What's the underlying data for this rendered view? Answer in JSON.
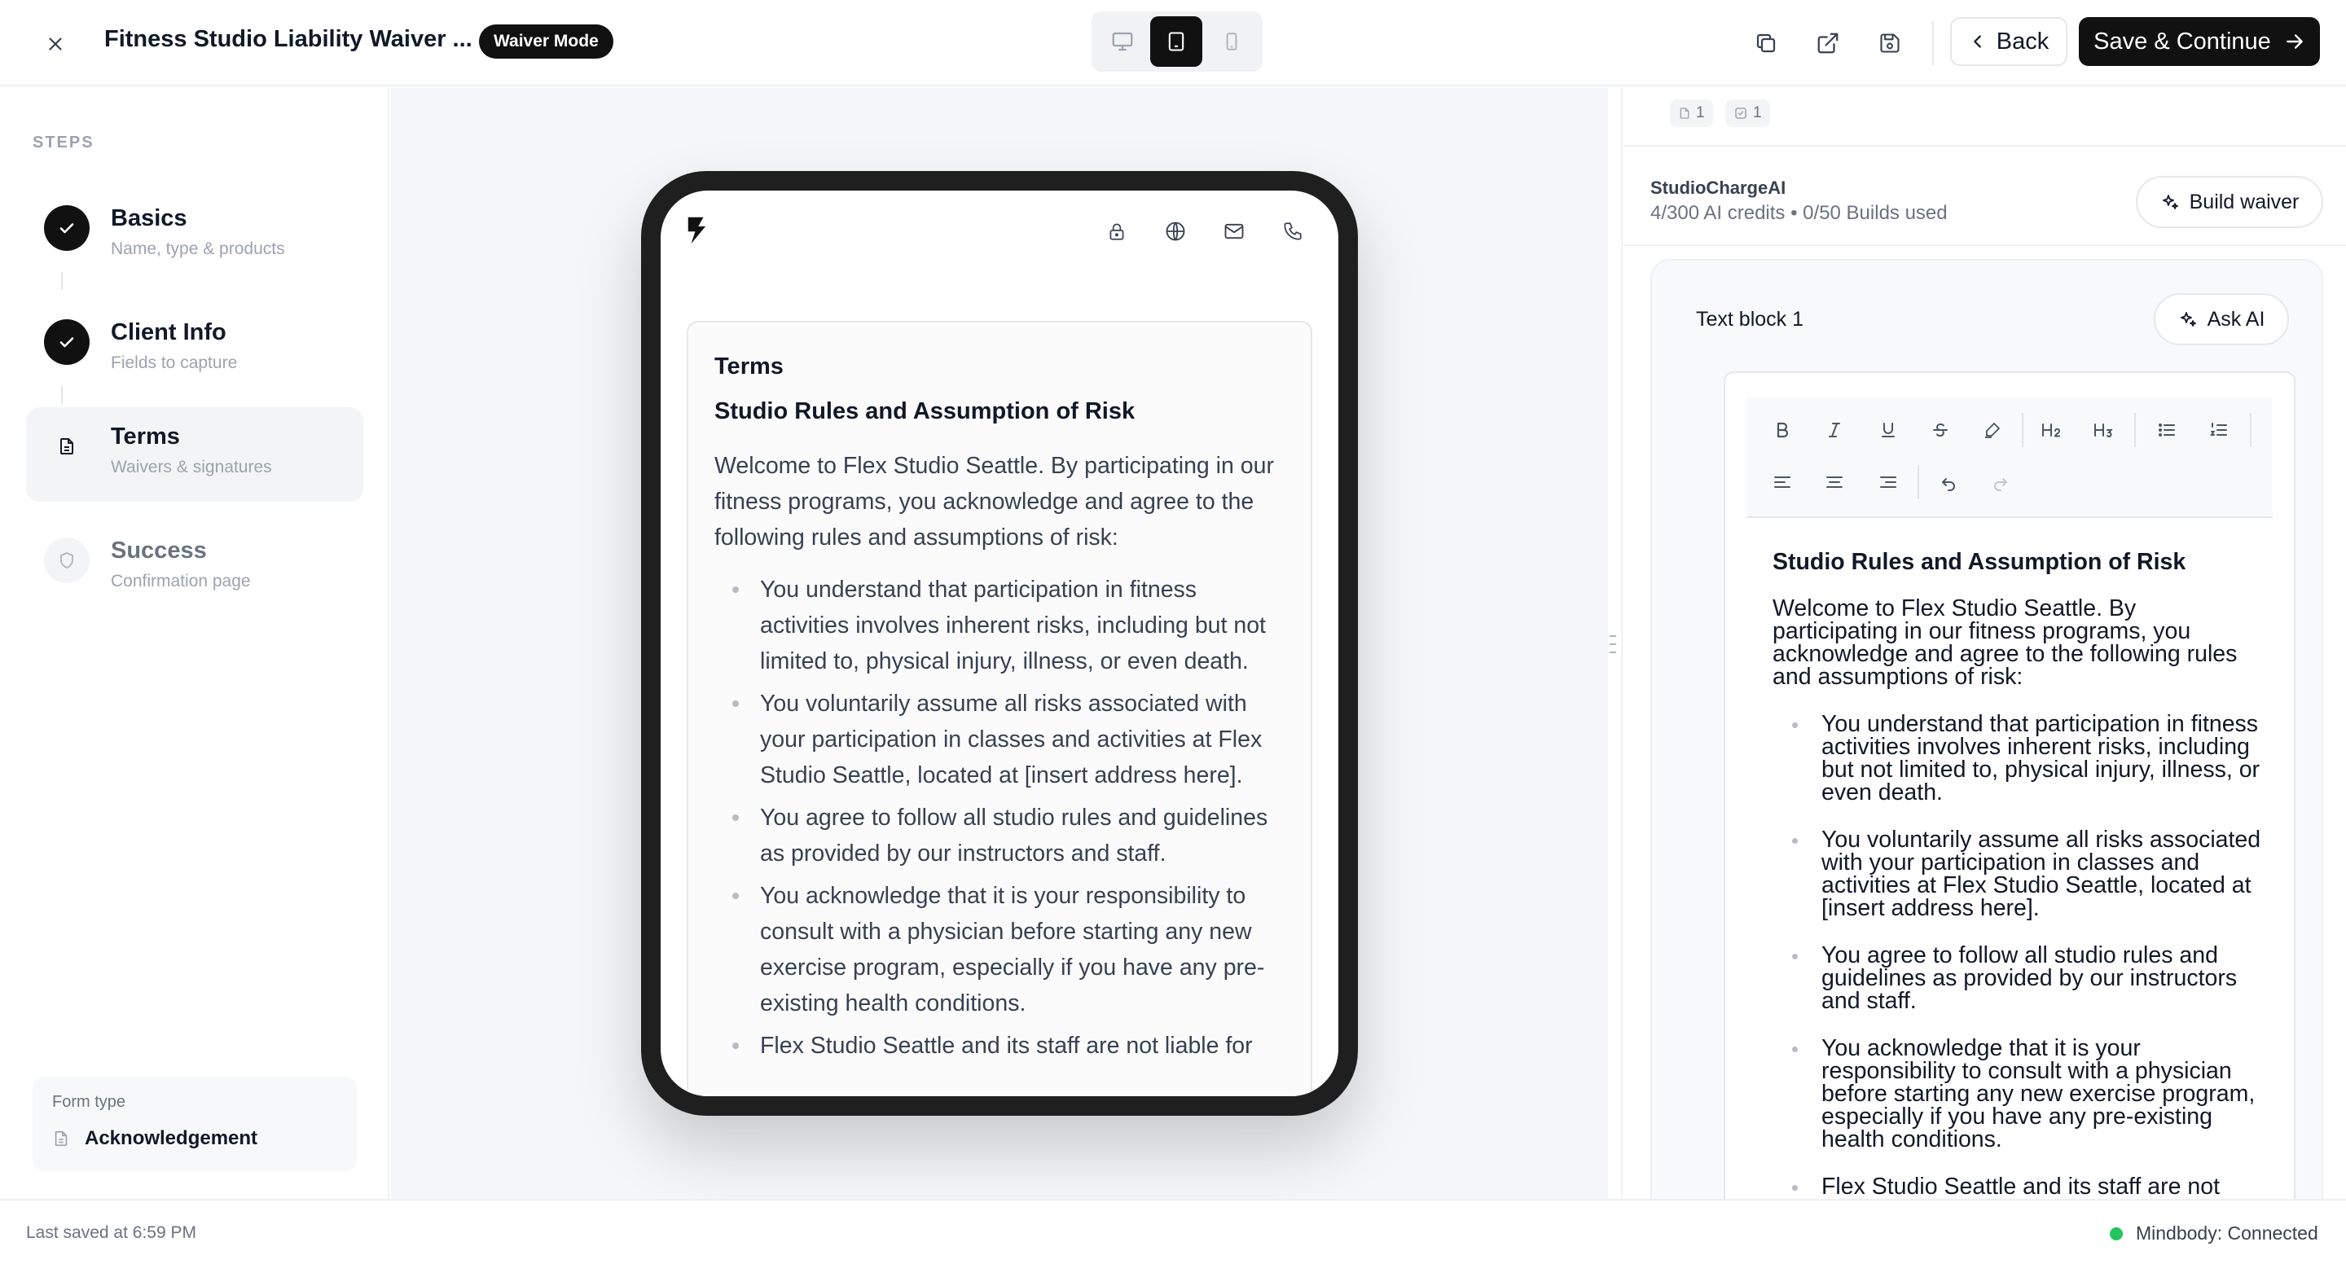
{
  "header": {
    "title": "Fitness Studio Liability Waiver ...",
    "mode_badge": "Waiver Mode",
    "device_options": [
      "desktop",
      "tablet",
      "mobile"
    ],
    "active_device": "tablet",
    "back_label": "Back",
    "save_label": "Save & Continue"
  },
  "sidebar": {
    "heading": "STEPS",
    "steps": [
      {
        "title": "Basics",
        "subtitle": "Name, type & products",
        "state": "done"
      },
      {
        "title": "Client Info",
        "subtitle": "Fields to capture",
        "state": "done"
      },
      {
        "title": "Terms",
        "subtitle": "Waivers & signatures",
        "state": "current"
      },
      {
        "title": "Success",
        "subtitle": "Confirmation page",
        "state": "pending"
      }
    ],
    "form_type": {
      "label": "Form type",
      "value": "Acknowledgement"
    }
  },
  "preview": {
    "card_title": "Terms",
    "heading": "Studio Rules and Assumption of Risk",
    "intro": "Welcome to Flex Studio Seattle. By participating in our fitness programs, you acknowledge and agree to the following rules and assumptions of risk:",
    "items": [
      "You understand that participation in fitness activities involves inherent risks, including but not limited to, physical injury, illness, or even death.",
      "You voluntarily assume all risks associated with your participation in classes and activities at Flex Studio Seattle, located at [insert address here].",
      "You agree to follow all studio rules and guidelines as provided by our instructors and staff.",
      "You acknowledge that it is your responsibility to consult with a physician before starting any new exercise program, especially if you have any pre-existing health conditions.",
      "Flex Studio Seattle and its staff are not liable for"
    ]
  },
  "right_panel": {
    "chip_pages": "1",
    "chip_checks": "1",
    "ai_name": "StudioChargeAI",
    "ai_credits": "4/300 AI credits • 0/50 Builds used",
    "build_label": "Build waiver",
    "block_title": "Text block 1",
    "ask_label": "Ask AI",
    "editor": {
      "heading": "Studio Rules and Assumption of Risk",
      "intro": "Welcome to Flex Studio Seattle. By participating in our fitness programs, you acknowledge and agree to the following rules and assumptions of risk:",
      "items": [
        "You understand that participation in fitness activities involves inherent risks, including but not limited to, physical injury, illness, or even death.",
        "You voluntarily assume all risks associated with your participation in classes and activities at Flex Studio Seattle, located at [insert address here].",
        "You agree to follow all studio rules and guidelines as provided by our instructors and staff.",
        "You acknowledge that it is your responsibility to consult with a physician before starting any new exercise program, especially if you have any pre-existing health conditions.",
        "Flex Studio Seattle and its staff are not"
      ]
    }
  },
  "status": {
    "saved": "Last saved at 6:59 PM",
    "connection": "Mindbody: Connected",
    "connection_color": "#22c55e"
  }
}
